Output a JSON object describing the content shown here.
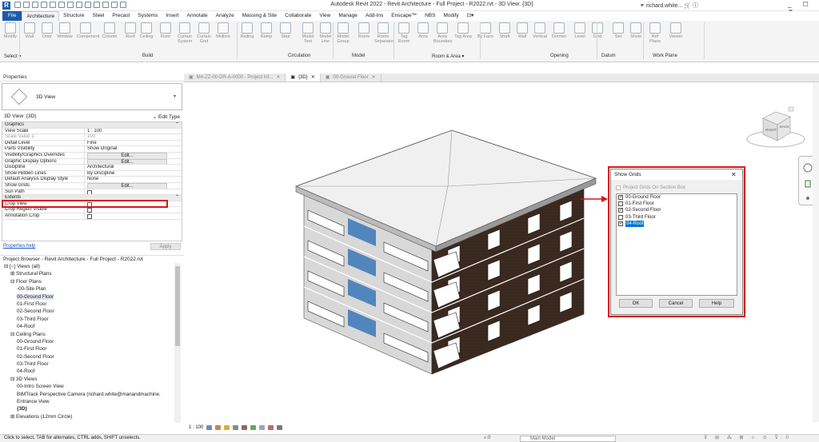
{
  "titlebar": {
    "logo": "R",
    "title": "Autodesk Revit 2022 - Revit Architecture - Full Project - R2022.rvt - 3D View: {3D}",
    "user": "richard.white...",
    "win_controls": "_ ☐ ✕"
  },
  "ribbon_tabs": [
    "File",
    "Architecture",
    "Structure",
    "Steel",
    "Precast",
    "Systems",
    "Insert",
    "Annotate",
    "Analyze",
    "Massing & Site",
    "Collaborate",
    "View",
    "Manage",
    "Add-Ins",
    "Enscape™",
    "NBS",
    "Modify",
    "⊡▾"
  ],
  "ribbon": {
    "buttons": [
      {
        "label": "Modify",
        "icon": "modify-arrow-icon"
      },
      {
        "label": "Wall",
        "icon": "wall-icon"
      },
      {
        "label": "Door",
        "icon": "door-icon"
      },
      {
        "label": "Window",
        "icon": "window-icon"
      },
      {
        "label": "Component",
        "icon": "component-icon"
      },
      {
        "label": "Column",
        "icon": "column-icon"
      },
      {
        "label": "Roof",
        "icon": "roof-icon"
      },
      {
        "label": "Ceiling",
        "icon": "ceiling-icon"
      },
      {
        "label": "Floor",
        "icon": "floor-icon"
      },
      {
        "label": "Curtain System",
        "icon": "curtain-system-icon"
      },
      {
        "label": "Curtain Grid",
        "icon": "curtain-grid-icon"
      },
      {
        "label": "Mullion",
        "icon": "mullion-icon"
      },
      {
        "label": "Railing",
        "icon": "railing-icon"
      },
      {
        "label": "Ramp",
        "icon": "ramp-icon"
      },
      {
        "label": "Stair",
        "icon": "stair-icon"
      },
      {
        "label": "Model Text",
        "icon": "model-text-icon"
      },
      {
        "label": "Model Line",
        "icon": "model-line-icon"
      },
      {
        "label": "Model Group",
        "icon": "model-group-icon"
      },
      {
        "label": "Room",
        "icon": "room-icon"
      },
      {
        "label": "Room Separator",
        "icon": "room-separator-icon"
      },
      {
        "label": "Tag Room",
        "icon": "tag-room-icon"
      },
      {
        "label": "Area",
        "icon": "area-icon"
      },
      {
        "label": "Area Boundary",
        "icon": "area-boundary-icon"
      },
      {
        "label": "Tag Area",
        "icon": "tag-area-icon"
      },
      {
        "label": "By Face",
        "icon": "by-face-icon"
      },
      {
        "label": "Shaft",
        "icon": "shaft-icon"
      },
      {
        "label": "Wall",
        "icon": "wall-opening-icon"
      },
      {
        "label": "Vertical",
        "icon": "vertical-opening-icon"
      },
      {
        "label": "Dormer",
        "icon": "dormer-icon"
      },
      {
        "label": "Level",
        "icon": "level-icon"
      },
      {
        "label": "Grid",
        "icon": "grid-icon"
      },
      {
        "label": "Set",
        "icon": "set-icon"
      },
      {
        "label": "Show",
        "icon": "show-icon"
      },
      {
        "label": "Ref Plane",
        "icon": "ref-plane-icon"
      },
      {
        "label": "Viewer",
        "icon": "viewer-icon"
      }
    ],
    "panels": [
      "Select ▾",
      "Build",
      "Circulation",
      "Model",
      "Room & Area ▾",
      "Opening",
      "Datum",
      "Work Plane"
    ]
  },
  "properties": {
    "header": "Properties",
    "type_name": "3D View",
    "instance": "3D View: {3D}",
    "edit_type": "Edit Type",
    "rows": [
      {
        "k": "Graphics",
        "v": "",
        "grp": true
      },
      {
        "k": "View Scale",
        "v": "1 : 100"
      },
      {
        "k": "Scale Value    1:",
        "v": "100",
        "dim": true
      },
      {
        "k": "Detail Level",
        "v": "Fine"
      },
      {
        "k": "Parts Visibility",
        "v": "Show Original"
      },
      {
        "k": "Visibility/Graphics Overrides",
        "v": "Edit...",
        "btn": true
      },
      {
        "k": "Graphic Display Options",
        "v": "Edit...",
        "btn": true
      },
      {
        "k": "Discipline",
        "v": "Architectural"
      },
      {
        "k": "Show Hidden Lines",
        "v": "By Discipline"
      },
      {
        "k": "Default Analysis Display Style",
        "v": "None"
      },
      {
        "k": "Show Grids",
        "v": "Edit...",
        "btn": true,
        "hl": true
      },
      {
        "k": "Sun Path",
        "v": "",
        "cb": true
      },
      {
        "k": "Extents",
        "v": "",
        "grp": true
      },
      {
        "k": "Crop View",
        "v": "",
        "cb": true
      },
      {
        "k": "Crop Region Visible",
        "v": "",
        "cb": true
      },
      {
        "k": "Annotation Crop",
        "v": "",
        "cb": true
      }
    ],
    "help": "Properties help",
    "apply": "Apply"
  },
  "project_browser": {
    "header": "Project Browser - Revit Architecture - Full Project - R2022.rvt",
    "nodes": [
      {
        "t": "⊟ [○] Views (all)",
        "d": 0
      },
      {
        "t": "⊞ Structural Plans",
        "d": 1
      },
      {
        "t": "⊟ Floor Plans",
        "d": 1
      },
      {
        "t": "-00-Site Plan",
        "d": 2
      },
      {
        "t": "00-Ground Floor",
        "d": 2,
        "sel": true
      },
      {
        "t": "01-First Floor",
        "d": 2
      },
      {
        "t": "02-Second Floor",
        "d": 2
      },
      {
        "t": "03-Third Floor",
        "d": 2
      },
      {
        "t": "04-Roof",
        "d": 2
      },
      {
        "t": "⊟ Ceiling Plans",
        "d": 1
      },
      {
        "t": "00-Ground Floor",
        "d": 2
      },
      {
        "t": "01-First Floor",
        "d": 2
      },
      {
        "t": "02-Second Floor",
        "d": 2
      },
      {
        "t": "03-Third Floor",
        "d": 2
      },
      {
        "t": "04-Roof",
        "d": 2
      },
      {
        "t": "⊟ 3D Views",
        "d": 1
      },
      {
        "t": "00-Intro Screen View",
        "d": 2
      },
      {
        "t": "BIMTrack Perspective Camera (richard.white@manandmachine.",
        "d": 2
      },
      {
        "t": "Entrance View",
        "d": 2
      },
      {
        "t": "{3D}",
        "d": 2,
        "bold": true
      },
      {
        "t": "⊞ Elevations (12mm Circle)",
        "d": 1
      }
    ]
  },
  "view_tabs": [
    {
      "label": "M4-ZZ-00-DR-A-0000 - Project Inf...",
      "on": false
    },
    {
      "label": "{3D}",
      "on": true
    },
    {
      "label": "00-Ground Floor",
      "on": false
    }
  ],
  "view_bar": {
    "scale": "1 : 100"
  },
  "viewcube": {
    "faces": [
      "RIGHT",
      "BACK"
    ]
  },
  "dialog": {
    "title": "Show Grids",
    "section_box": "Project Grids On Section Box",
    "items": [
      {
        "label": "00-Ground Floor",
        "checked": true
      },
      {
        "label": "01-First Floor",
        "checked": false
      },
      {
        "label": "02-Second Floor",
        "checked": true
      },
      {
        "label": "03-Third Floor",
        "checked": false
      },
      {
        "label": "04-Roof",
        "checked": true,
        "selected": true
      }
    ],
    "ok": "OK",
    "cancel": "Cancel",
    "help": "Help"
  },
  "status": {
    "message": "Click to select, TAB for alternates, CTRL adds, SHIFT unselects.",
    "model": "Main Model",
    "zero": ":0"
  },
  "colors": {
    "accent": "#1d5aa8",
    "highlight": "#d9151b",
    "selection": "#0078d7",
    "brick": "#3b2a20"
  }
}
